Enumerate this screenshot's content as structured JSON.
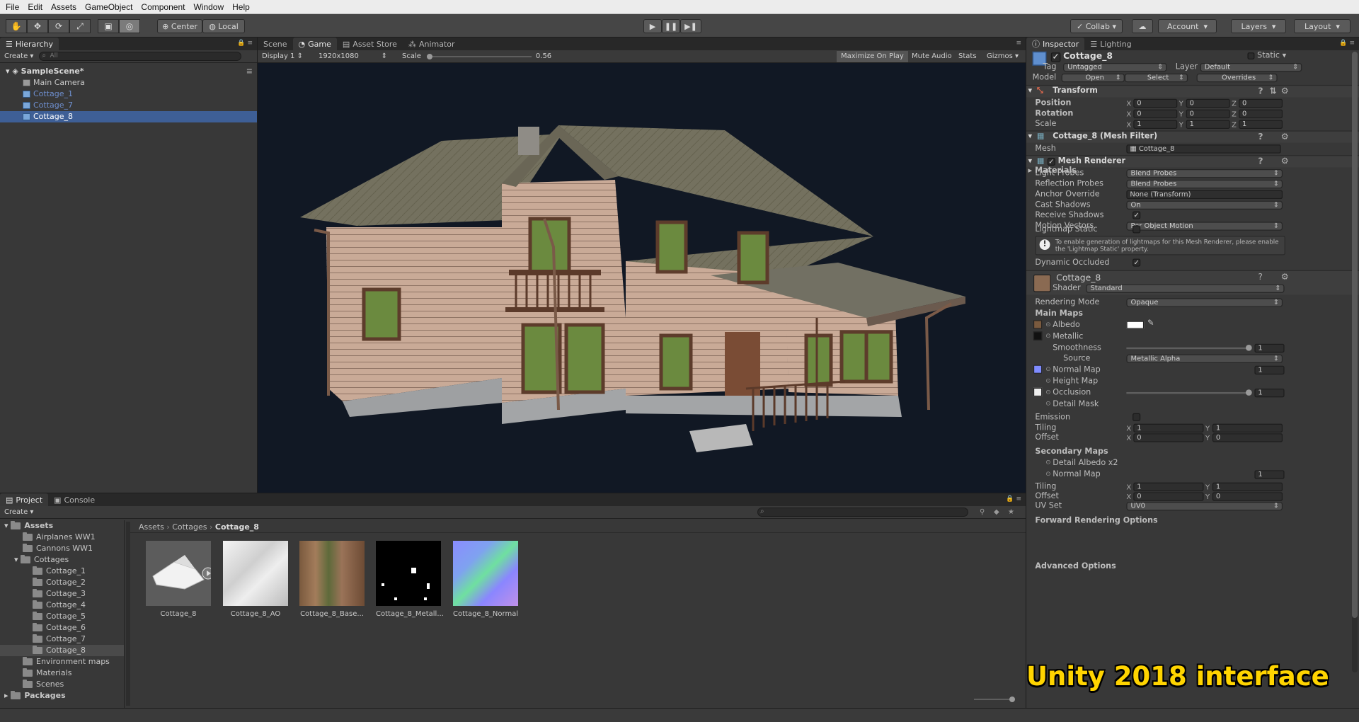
{
  "menu": [
    "File",
    "Edit",
    "Assets",
    "GameObject",
    "Component",
    "Window",
    "Help"
  ],
  "toolbar": {
    "pivot": "Center",
    "space": "Local",
    "collab": "Collab",
    "account": "Account",
    "layers": "Layers",
    "layout": "Layout"
  },
  "hierarchy": {
    "tab": "Hierarchy",
    "create": "Create",
    "search_placeholder": "All",
    "scene": "SampleScene*",
    "items": [
      "Main Camera",
      "Cottage_1",
      "Cottage_7",
      "Cottage_8"
    ]
  },
  "game": {
    "tabs": [
      "Scene",
      "Game",
      "Asset Store",
      "Animator"
    ],
    "display": "Display 1",
    "resolution": "1920x1080",
    "scale_label": "Scale",
    "scale_value": "0.56",
    "maximize": "Maximize On Play",
    "mute": "Mute Audio",
    "stats": "Stats",
    "gizmos": "Gizmos"
  },
  "inspector": {
    "tabs": [
      "Inspector",
      "Lighting"
    ],
    "object_name": "Cottage_8",
    "static": "Static",
    "tag_label": "Tag",
    "tag": "Untagged",
    "layer_label": "Layer",
    "layer": "Default",
    "model_label": "Model",
    "model_open": "Open",
    "model_select": "Select",
    "model_overrides": "Overrides",
    "transform": {
      "title": "Transform",
      "position_label": "Position",
      "rotation_label": "Rotation",
      "scale_label": "Scale",
      "position": [
        "0",
        "0",
        "0"
      ],
      "rotation": [
        "0",
        "0",
        "0"
      ],
      "scale": [
        "1",
        "1",
        "1"
      ]
    },
    "mesh_filter": {
      "title": "Cottage_8 (Mesh Filter)",
      "mesh_label": "Mesh",
      "mesh": "Cottage_8"
    },
    "mesh_renderer": {
      "title": "Mesh Renderer",
      "materials": "Materials",
      "light_probes_label": "Light Probes",
      "light_probes": "Blend Probes",
      "reflection_label": "Reflection Probes",
      "reflection": "Blend Probes",
      "anchor_label": "Anchor Override",
      "anchor": "None (Transform)",
      "cast_label": "Cast Shadows",
      "cast": "On",
      "receive_label": "Receive Shadows",
      "motion_label": "Motion Vectors",
      "motion": "Per Object Motion",
      "lightmap_label": "Lightmap Static",
      "warning": "To enable generation of lightmaps for this Mesh Renderer, please enable the 'Lightmap Static' property.",
      "occluded_label": "Dynamic Occluded"
    },
    "material": {
      "name": "Cottage_8",
      "shader_label": "Shader",
      "shader": "Standard",
      "rendering_mode_label": "Rendering Mode",
      "rendering_mode": "Opaque",
      "main_maps": "Main Maps",
      "albedo": "Albedo",
      "metallic": "Metallic",
      "smoothness": "Smoothness",
      "smoothness_value": "1",
      "source_label": "Source",
      "source": "Metallic Alpha",
      "normal_map": "Normal Map",
      "normal_value": "1",
      "height_map": "Height Map",
      "occlusion": "Occlusion",
      "occlusion_value": "1",
      "detail_mask": "Detail Mask",
      "emission": "Emission",
      "tiling_label": "Tiling",
      "tiling": [
        "1",
        "1"
      ],
      "offset_label": "Offset",
      "offset": [
        "0",
        "0"
      ],
      "secondary_maps": "Secondary Maps",
      "detail_albedo": "Detail Albedo x2",
      "normal_map2": "Normal Map",
      "normal2_value": "1",
      "tiling2": [
        "1",
        "1"
      ],
      "offset2": [
        "0",
        "0"
      ],
      "uv_set_label": "UV Set",
      "uv_set": "UV0",
      "forward": "Forward Rendering Options",
      "advanced": "Advanced Options"
    }
  },
  "project": {
    "tabs": [
      "Project",
      "Console"
    ],
    "create": "Create",
    "tree": {
      "assets": "Assets",
      "folders": [
        "Airplanes WW1",
        "Cannons WW1",
        "Cottages"
      ],
      "cottages": [
        "Cottage_1",
        "Cottage_2",
        "Cottage_3",
        "Cottage_4",
        "Cottage_5",
        "Cottage_6",
        "Cottage_7",
        "Cottage_8"
      ],
      "more": [
        "Environment maps",
        "Materials",
        "Scenes"
      ],
      "packages": "Packages"
    },
    "breadcrumb": [
      "Assets",
      "Cottages",
      "Cottage_8"
    ],
    "assets": [
      "Cottage_8",
      "Cottage_8_AO",
      "Cottage_8_Base...",
      "Cottage_8_Metall...",
      "Cottage_8_Normal"
    ]
  },
  "overlay_caption": "Unity 2018 interface",
  "colors": {
    "selection": "#3e5f96",
    "prefab_text": "#7aa7e8",
    "caption": "#ffd400"
  }
}
